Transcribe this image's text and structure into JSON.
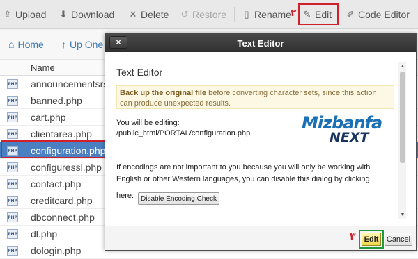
{
  "toolbar": {
    "upload": "Upload",
    "download": "Download",
    "delete": "Delete",
    "restore": "Restore",
    "rename": "Rename",
    "edit": "Edit",
    "code_editor": "Code Editor"
  },
  "nav": {
    "home": "Home",
    "up_one": "Up One"
  },
  "file_list": {
    "header_name": "Name",
    "files": [
      "announcementsrss",
      "banned.php",
      "cart.php",
      "clientarea.php",
      "configuration.php",
      "configuressl.php",
      "contact.php",
      "creditcard.php",
      "dbconnect.php",
      "dl.php",
      "dologin.php"
    ],
    "selected_index": 4,
    "file_icon_text": "PHP"
  },
  "dialog": {
    "title": "Text Editor",
    "close_symbol": "✕",
    "heading": "Text Editor",
    "warning_bold": "Back up the original file",
    "warning_rest": " before converting character sets, since this action can produce unexpected results.",
    "editing_label": "You will be editing:",
    "editing_path": "/public_html/PORTAL/configuration.php",
    "encoding_text": "If encodings are not important to you because you will only be working with English or other Western languages, you can disable this dialog by clicking",
    "here_label": "here:",
    "disable_button": "Disable Encoding Check",
    "edit_button": "Edit",
    "cancel_button": "Cancel"
  },
  "logo": {
    "line1": "Mizbanfa",
    "line2": "NEXT"
  },
  "annotations": {
    "step1": "۱",
    "step2": "۲",
    "step3": "۳"
  },
  "colors": {
    "annotation_red": "#d0202a",
    "annotation_green": "#1f9a3b",
    "selection_blue": "#4a7fc1",
    "link_blue": "#3a7ab3"
  },
  "icons": {
    "upload": "upload-icon",
    "download": "download-icon",
    "delete": "close-icon",
    "restore": "undo-icon",
    "rename": "file-icon",
    "edit": "pencil-icon",
    "code_editor": "code-edit-icon",
    "home": "home-icon",
    "up_one": "arrow-up-icon"
  }
}
